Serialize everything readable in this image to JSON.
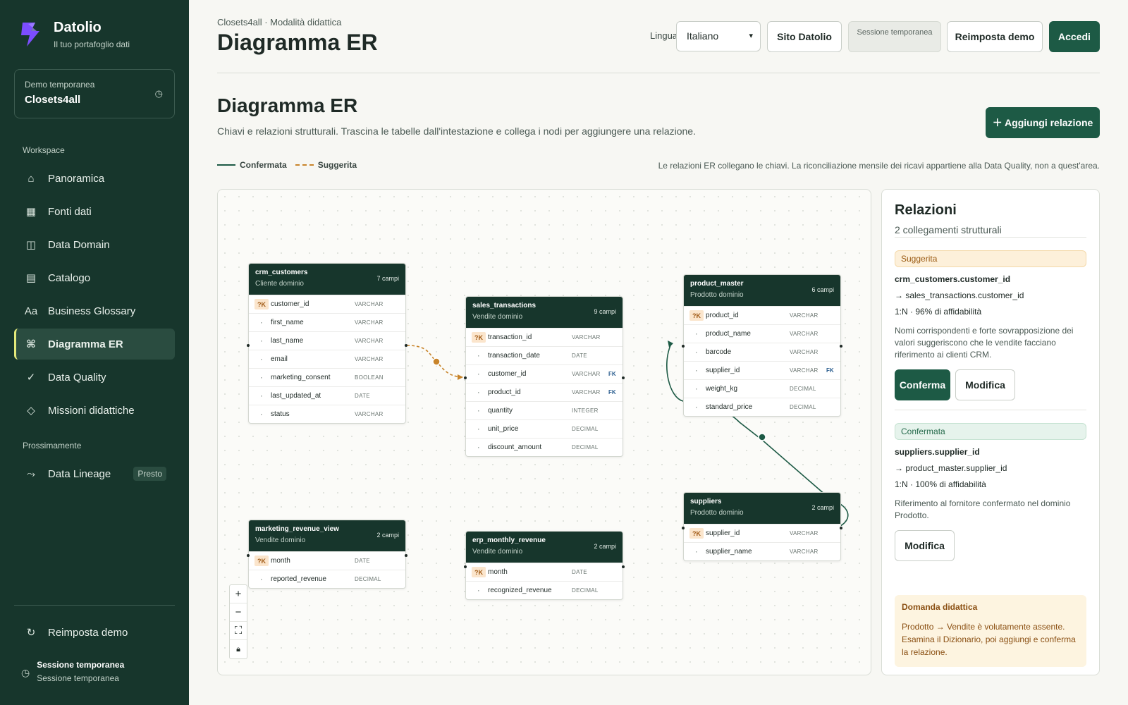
{
  "brand": {
    "name": "Datolio",
    "tagline": "Il tuo portafoglio dati"
  },
  "demo": {
    "label": "Demo temporanea",
    "value": "Closets4all"
  },
  "sidebar": {
    "section_workspace": "Workspace",
    "items": [
      {
        "label": "Panoramica",
        "icon": "home-icon",
        "glyph": "⌂"
      },
      {
        "label": "Fonti dati",
        "icon": "grid-icon",
        "glyph": "▦"
      },
      {
        "label": "Data Domain",
        "icon": "domain-icon",
        "glyph": "◫"
      },
      {
        "label": "Catalogo",
        "icon": "catalog-icon",
        "glyph": "▤"
      },
      {
        "label": "Business Glossary",
        "icon": "glossary-icon",
        "glyph": "Aa"
      },
      {
        "label": "Diagramma ER",
        "icon": "command-icon",
        "glyph": "⌘"
      },
      {
        "label": "Data Quality",
        "icon": "check-icon",
        "glyph": "✓"
      },
      {
        "label": "Missioni didattiche",
        "icon": "diamond-icon",
        "glyph": "◇"
      }
    ],
    "section_soon": "Prossimamente",
    "soon_item": {
      "label": "Data Lineage",
      "badge": "Presto",
      "glyph": "⤳"
    },
    "reset_label": "Reimposta demo",
    "session_title": "Sessione temporanea",
    "session_sub": "Sessione temporanea"
  },
  "header": {
    "breadcrumb": "Closets4all · Modalità didattica",
    "title": "Diagramma ER",
    "lang_label": "Lingua",
    "lang_value": "Italiano",
    "site_button": "Sito Datolio",
    "session_chip": "Sessione temporanea",
    "reset_button": "Reimposta demo",
    "login_button": "Accedi"
  },
  "section": {
    "title": "Diagramma ER",
    "subtitle": "Chiavi e relazioni strutturali. Trascina le tabelle dall'intestazione e collega i nodi per aggiungere una relazione.",
    "add_button": "＋ Aggiungi relazione",
    "legend_confirmed": "Confermata",
    "legend_suggested": "Suggerita",
    "note": "Le relazioni ER collegano le chiavi. La riconciliazione mensile dei ricavi appartiene alla Data Quality, non a quest'area."
  },
  "tables": [
    {
      "name": "crm_customers",
      "domain": "Cliente dominio",
      "count": "7 campi",
      "fields": [
        {
          "name": "customer_id",
          "type": "VARCHAR",
          "key": "?K",
          "fk": ""
        },
        {
          "name": "first_name",
          "type": "VARCHAR",
          "key": "·",
          "fk": ""
        },
        {
          "name": "last_name",
          "type": "VARCHAR",
          "key": "·",
          "fk": ""
        },
        {
          "name": "email",
          "type": "VARCHAR",
          "key": "·",
          "fk": ""
        },
        {
          "name": "marketing_consent",
          "type": "BOOLEAN",
          "key": "·",
          "fk": ""
        },
        {
          "name": "last_updated_at",
          "type": "DATE",
          "key": "·",
          "fk": ""
        },
        {
          "name": "status",
          "type": "VARCHAR",
          "key": "·",
          "fk": ""
        }
      ]
    },
    {
      "name": "sales_transactions",
      "domain": "Vendite dominio",
      "count": "9 campi",
      "fields": [
        {
          "name": "transaction_id",
          "type": "VARCHAR",
          "key": "?K",
          "fk": ""
        },
        {
          "name": "transaction_date",
          "type": "DATE",
          "key": "·",
          "fk": ""
        },
        {
          "name": "customer_id",
          "type": "VARCHAR",
          "key": "·",
          "fk": "FK"
        },
        {
          "name": "product_id",
          "type": "VARCHAR",
          "key": "·",
          "fk": "FK"
        },
        {
          "name": "quantity",
          "type": "INTEGER",
          "key": "·",
          "fk": ""
        },
        {
          "name": "unit_price",
          "type": "DECIMAL",
          "key": "·",
          "fk": ""
        },
        {
          "name": "discount_amount",
          "type": "DECIMAL",
          "key": "·",
          "fk": ""
        }
      ]
    },
    {
      "name": "product_master",
      "domain": "Prodotto dominio",
      "count": "6 campi",
      "fields": [
        {
          "name": "product_id",
          "type": "VARCHAR",
          "key": "?K",
          "fk": ""
        },
        {
          "name": "product_name",
          "type": "VARCHAR",
          "key": "·",
          "fk": ""
        },
        {
          "name": "barcode",
          "type": "VARCHAR",
          "key": "·",
          "fk": ""
        },
        {
          "name": "supplier_id",
          "type": "VARCHAR",
          "key": "·",
          "fk": "FK"
        },
        {
          "name": "weight_kg",
          "type": "DECIMAL",
          "key": "·",
          "fk": ""
        },
        {
          "name": "standard_price",
          "type": "DECIMAL",
          "key": "·",
          "fk": ""
        }
      ]
    },
    {
      "name": "suppliers",
      "domain": "Prodotto dominio",
      "count": "2 campi",
      "fields": [
        {
          "name": "supplier_id",
          "type": "VARCHAR",
          "key": "?K",
          "fk": ""
        },
        {
          "name": "supplier_name",
          "type": "VARCHAR",
          "key": "·",
          "fk": ""
        }
      ]
    },
    {
      "name": "marketing_revenue_view",
      "domain": "Vendite dominio",
      "count": "2 campi",
      "fields": [
        {
          "name": "month",
          "type": "DATE",
          "key": "?K",
          "fk": ""
        },
        {
          "name": "reported_revenue",
          "type": "DECIMAL",
          "key": "·",
          "fk": ""
        }
      ]
    },
    {
      "name": "erp_monthly_revenue",
      "domain": "Vendite dominio",
      "count": "2 campi",
      "fields": [
        {
          "name": "month",
          "type": "DATE",
          "key": "?K",
          "fk": ""
        },
        {
          "name": "recognized_revenue",
          "type": "DECIMAL",
          "key": "·",
          "fk": ""
        }
      ]
    }
  ],
  "panel": {
    "title": "Relazioni",
    "subtitle": "2 collegamenti strutturali",
    "relations": [
      {
        "status": "Suggerita",
        "from": "crm_customers.customer_id",
        "to": "→ sales_transactions.customer_id",
        "meta": "1:N · 96% di affidabilità",
        "desc": "Nomi corrispondenti e forte sovrapposizione dei valori suggeriscono che le vendite facciano riferimento ai clienti CRM.",
        "confirm": "Conferma",
        "edit": "Modifica"
      },
      {
        "status": "Confermata",
        "from": "suppliers.supplier_id",
        "to": "→ product_master.supplier_id",
        "meta": "1:N · 100% di affidabilità",
        "desc": "Riferimento al fornitore confermato nel dominio Prodotto.",
        "edit": "Modifica"
      }
    ],
    "didactic_title": "Domanda didattica",
    "didactic_text": "Prodotto → Vendite è volutamente assente. Esamina il Dizionario, poi aggiungi e conferma la relazione."
  },
  "colors": {
    "sidebar": "#17362c",
    "accent": "#1d5a45",
    "suggested": "#c8842a"
  }
}
